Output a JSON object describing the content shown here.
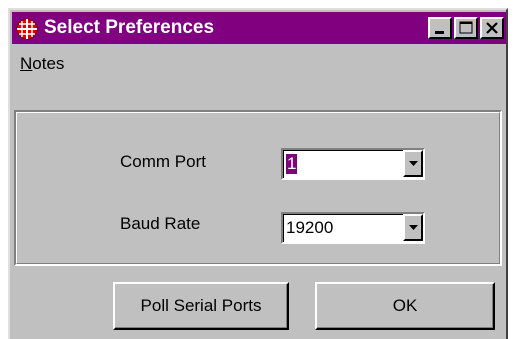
{
  "window": {
    "title": "Select Preferences",
    "title_bar_color": "#800080",
    "app_icon": "globe-grid-icon",
    "controls": {
      "minimize_icon": "minimize-icon",
      "maximize_icon": "maximize-icon",
      "close_icon": "close-icon"
    }
  },
  "menu": {
    "items": [
      {
        "label": "Notes",
        "mnemonic": "N",
        "rest": "otes"
      }
    ]
  },
  "form": {
    "comm_port": {
      "label": "Comm Port",
      "value": "1",
      "selected_highlight": "#800080",
      "dropdown_icon": "dropdown-arrow-icon"
    },
    "baud_rate": {
      "label": "Baud Rate",
      "value": "19200",
      "dropdown_icon": "dropdown-arrow-icon"
    }
  },
  "buttons": {
    "poll_label": "Poll Serial Ports",
    "ok_label": "OK"
  }
}
